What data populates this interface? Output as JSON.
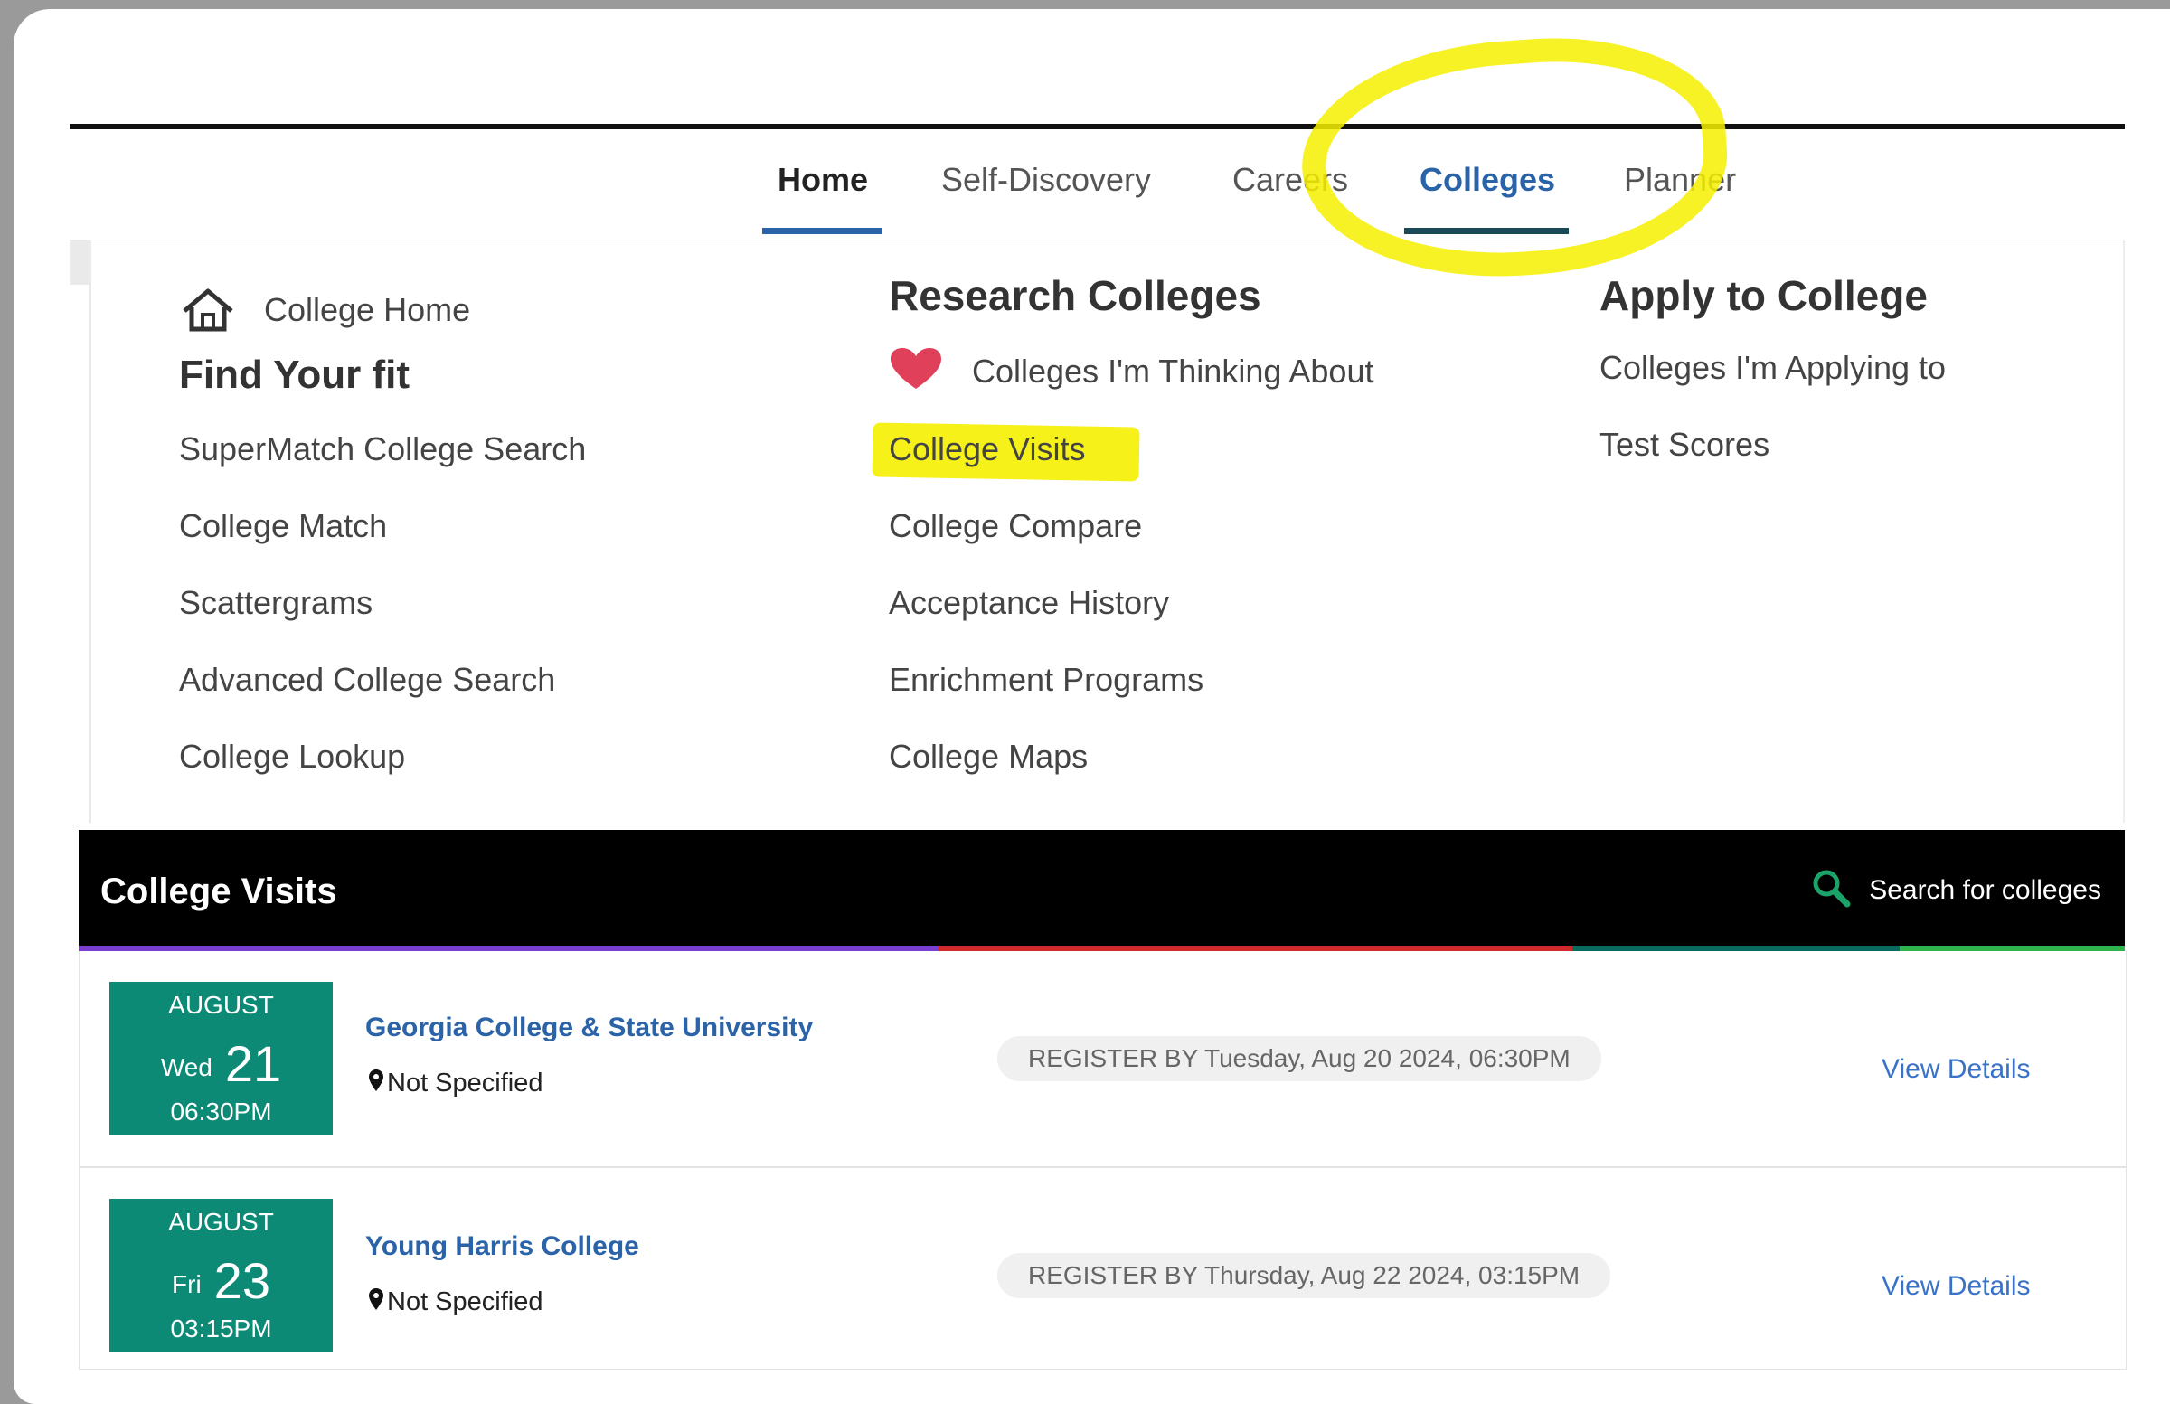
{
  "nav": {
    "items": [
      {
        "label": "Home"
      },
      {
        "label": "Self-Discovery"
      },
      {
        "label": "Careers"
      },
      {
        "label": "Colleges"
      },
      {
        "label": "Planner"
      }
    ],
    "home_underline_color": "#2a63a8",
    "colleges_underline_color": "#1a4a55"
  },
  "menu": {
    "college_home": "College Home",
    "find_fit": {
      "heading": "Find Your fit",
      "links": [
        "SuperMatch College Search",
        "College Match",
        "Scattergrams",
        "Advanced College Search",
        "College Lookup"
      ]
    },
    "research": {
      "heading": "Research Colleges",
      "thinking_about": "Colleges I'm Thinking About",
      "links": [
        "College Visits",
        "College Compare",
        "Acceptance History",
        "Enrichment Programs",
        "College Maps"
      ]
    },
    "apply": {
      "heading": "Apply to College",
      "links": [
        "Colleges I'm Applying to",
        "Test Scores"
      ]
    }
  },
  "visits": {
    "title": "College Visits",
    "search_label": "Search for colleges",
    "rows": [
      {
        "month": "AUGUST",
        "weekday": "Wed",
        "day": "21",
        "time": "06:30PM",
        "college": "Georgia College & State University",
        "location": "Not Specified",
        "register": "REGISTER BY Tuesday, Aug 20 2024, 06:30PM",
        "details": "View Details"
      },
      {
        "month": "AUGUST",
        "weekday": "Fri",
        "day": "23",
        "time": "03:15PM",
        "college": "Young Harris College",
        "location": "Not Specified",
        "register": "REGISTER BY Thursday, Aug 22 2024, 03:15PM",
        "details": "View Details"
      }
    ]
  },
  "colors": {
    "highlight": "#f4f000",
    "date_box": "#0d8a76",
    "link_blue": "#2a63a8",
    "heart": "#e0405a"
  }
}
